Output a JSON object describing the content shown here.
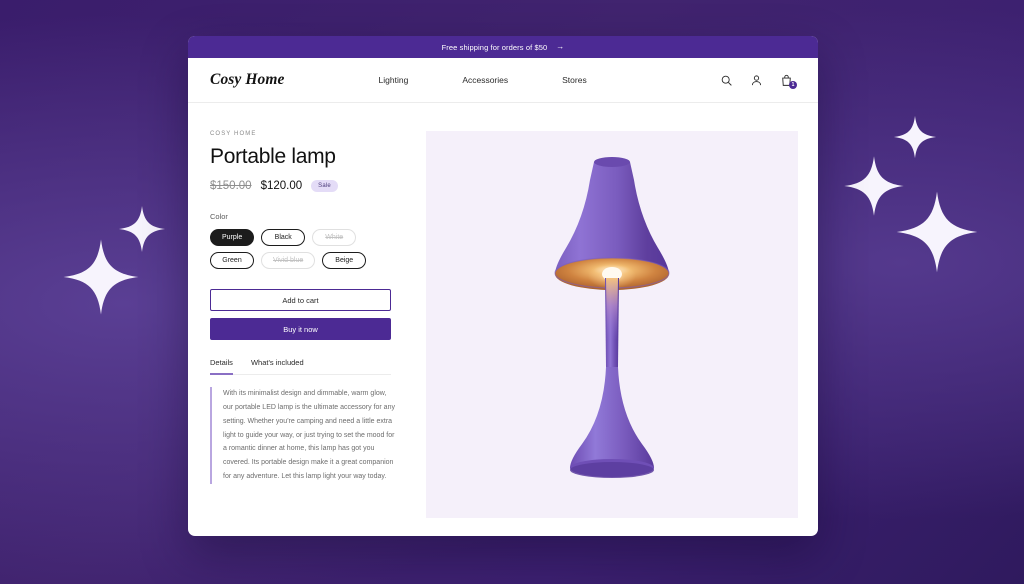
{
  "theme": {
    "brand_purple": "#4c2a94",
    "backdrop_purple": "#3b1f70",
    "media_bg": "#f5f0fa",
    "sale_pill_bg": "#e4dcf7"
  },
  "announcement": {
    "text": "Free shipping for orders of $50",
    "arrow": "→"
  },
  "header": {
    "logo": "Cosy Home",
    "nav": [
      {
        "label": "Lighting"
      },
      {
        "label": "Accessories"
      },
      {
        "label": "Stores"
      }
    ],
    "icons": {
      "search": "search-icon",
      "account": "account-icon",
      "cart": "cart-icon"
    },
    "cart_count": "1"
  },
  "product": {
    "vendor": "COSY HOME",
    "title": "Portable lamp",
    "price_compare": "$150.00",
    "price_current": "$120.00",
    "badge": "Sale",
    "option_label": "Color",
    "options": [
      {
        "label": "Purple",
        "state": "selected"
      },
      {
        "label": "Black",
        "state": "available"
      },
      {
        "label": "White",
        "state": "unavailable"
      },
      {
        "label": "Green",
        "state": "available"
      },
      {
        "label": "Vivid blue",
        "state": "unavailable"
      },
      {
        "label": "Beige",
        "state": "available"
      }
    ],
    "add_to_cart": "Add to cart",
    "buy_now": "Buy it now",
    "image_alt": "portable-lamp-image"
  },
  "tabs": [
    {
      "label": "Details",
      "active": true
    },
    {
      "label": "What's included",
      "active": false
    }
  ],
  "description": "With its minimalist design and dimmable, warm glow, our portable LED lamp is the ultimate accessory for any setting. Whether you're camping and need a little extra light to guide your way, or just trying to set the mood for a romantic dinner at home, this lamp has got you covered. Its portable design make it a great companion for any adventure. Let this lamp light your way today."
}
